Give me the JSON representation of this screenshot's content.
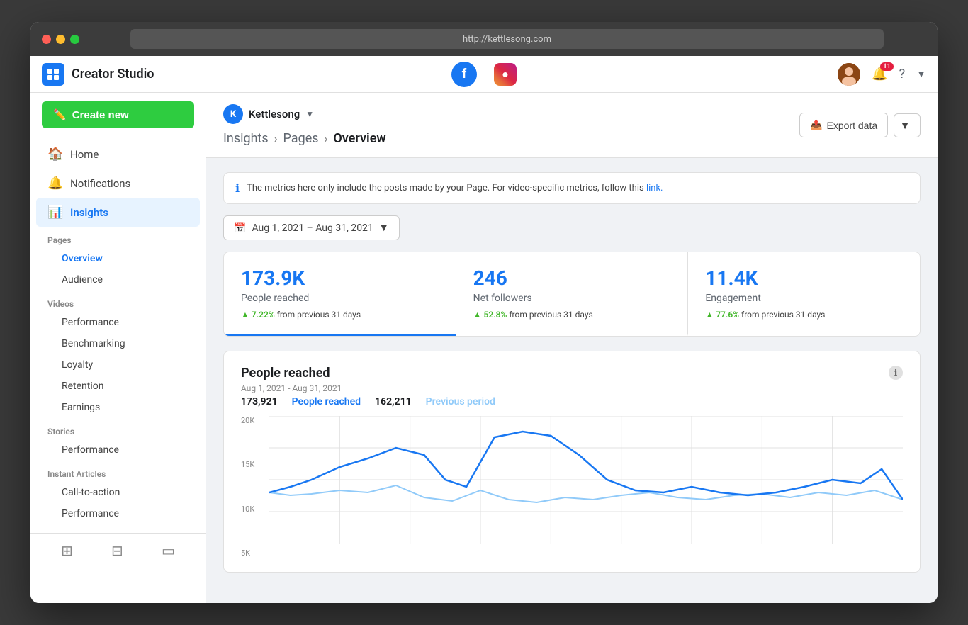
{
  "browser": {
    "url": "http://kettlesong.com"
  },
  "header": {
    "app_name": "Creator Studio",
    "logo_letter": "f",
    "notification_count": "11",
    "platform_fb": "Facebook",
    "platform_ig": "Instagram"
  },
  "sidebar": {
    "create_btn": "Create new",
    "home": "Home",
    "notifications": "Notifications",
    "insights": "Insights",
    "sections": {
      "pages": {
        "label": "Pages",
        "items": [
          "Overview",
          "Audience"
        ]
      },
      "videos": {
        "label": "Videos",
        "items": [
          "Performance",
          "Benchmarking",
          "Loyalty",
          "Retention",
          "Earnings"
        ]
      },
      "stories": {
        "label": "Stories",
        "items": [
          "Performance"
        ]
      },
      "instant_articles": {
        "label": "Instant Articles",
        "items": [
          "Call-to-action",
          "Performance"
        ]
      }
    },
    "footer_icons": [
      "grid-icon",
      "table-icon",
      "tablet-icon"
    ]
  },
  "page_selector": {
    "name": "Kettlesong",
    "initial": "K"
  },
  "breadcrumb": {
    "items": [
      "Insights",
      "Pages",
      "Overview"
    ]
  },
  "export": {
    "label": "Export data"
  },
  "info_banner": {
    "text": "The metrics here only include the posts made by your Page. For video-specific metrics, follow this",
    "link": "link."
  },
  "date_filter": {
    "value": "Aug 1, 2021 – Aug 31, 2021"
  },
  "stats": [
    {
      "value": "173.9K",
      "label": "People reached",
      "change_pct": "7.22%",
      "change_text": "from previous 31 days",
      "active": true
    },
    {
      "value": "246",
      "label": "Net followers",
      "change_pct": "52.8%",
      "change_text": "from previous 31 days",
      "active": false
    },
    {
      "value": "11.4K",
      "label": "Engagement",
      "change_pct": "77.6%",
      "change_text": "from previous 31 days",
      "active": false
    }
  ],
  "chart": {
    "title": "People reached",
    "subtitle": "Aug 1, 2021 - Aug 31, 2021",
    "current_value": "173,921",
    "current_label": "People reached",
    "prev_value": "162,211",
    "prev_label": "Previous period",
    "y_labels": [
      "20K",
      "15K",
      "10K",
      "5K"
    ],
    "colors": {
      "current": "#1877f2",
      "previous": "#90caf9"
    }
  }
}
